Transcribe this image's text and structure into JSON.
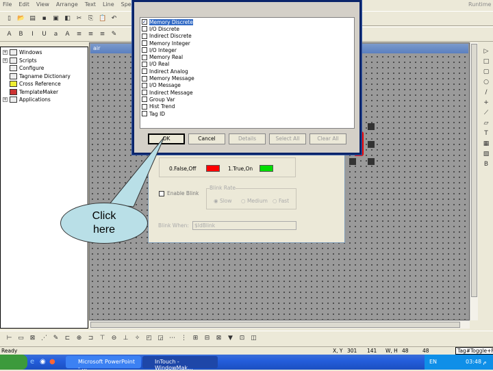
{
  "menu": [
    "File",
    "Edit",
    "View",
    "Arrange",
    "Text",
    "Line",
    "Special",
    "Wi"
  ],
  "menu_right": "Runtime",
  "tree": [
    {
      "label": "Windows",
      "expand": "+"
    },
    {
      "label": "Scripts",
      "expand": "+"
    },
    {
      "label": "Configure",
      "expand": ""
    },
    {
      "label": "Tagname Dictionary",
      "expand": ""
    },
    {
      "label": "Cross Reference",
      "expand": ""
    },
    {
      "label": "TemplateMaker",
      "expand": ""
    },
    {
      "label": "Applications",
      "expand": "+"
    }
  ],
  "window_title": "air",
  "dialog": {
    "items": [
      {
        "label": "Memory Discrete",
        "checked": true
      },
      {
        "label": "I/O Discrete",
        "checked": false
      },
      {
        "label": "Indirect Discrete",
        "checked": false
      },
      {
        "label": "Memory Integer",
        "checked": false
      },
      {
        "label": "I/O Integer",
        "checked": false
      },
      {
        "label": "Memory Real",
        "checked": false
      },
      {
        "label": "I/O Real",
        "checked": false
      },
      {
        "label": "Indirect Analog",
        "checked": false
      },
      {
        "label": "Memory Message",
        "checked": false
      },
      {
        "label": "I/O Message",
        "checked": false
      },
      {
        "label": "Indirect Message",
        "checked": false
      },
      {
        "label": "Group Var",
        "checked": false
      },
      {
        "label": "Hist Trend",
        "checked": false
      },
      {
        "label": "Tag ID",
        "checked": false
      }
    ],
    "ok": "OK",
    "cancel": "Cancel",
    "details": "Details",
    "select_all": "Select All",
    "clear_all": "Clear All"
  },
  "prop": {
    "false_label": "0.False,Off",
    "true_label": "1.True,On",
    "false_color": "#ff0000",
    "true_color": "#00dd00",
    "enable_blink": "Enable Blink",
    "blink_rate": "Blink Rate",
    "slow": "Slow",
    "medium": "Medium",
    "fast": "Fast",
    "blink_when": "Blink When:",
    "blink_when_value": "$IdBlink"
  },
  "callout": {
    "line1": "Click",
    "line2": "here"
  },
  "status": {
    "text": "Ready",
    "xy_label": "X, Y",
    "x": "301",
    "y": "141",
    "wh_label": "W, H",
    "w": "48",
    "h": "48",
    "tag": "Tag#Toggle+F"
  },
  "taskbar": {
    "tasks": [
      "Microsoft PowerPoint - ...",
      "InTouch - WindowMak..."
    ],
    "lang": "EN",
    "clock": "03:48 م"
  }
}
